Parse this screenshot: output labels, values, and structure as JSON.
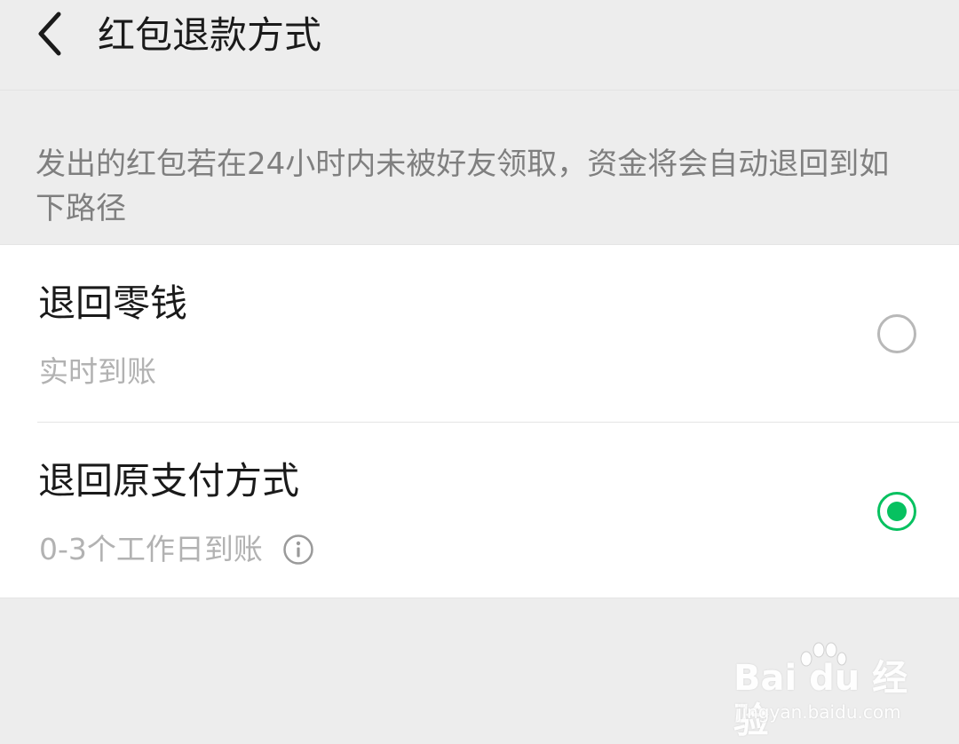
{
  "header": {
    "back_icon": "chevron-left-icon",
    "title": "红包退款方式"
  },
  "description": "发出的红包若在24小时内未被好友领取，资金将会自动退回到如下路径",
  "options": [
    {
      "title": "退回零钱",
      "subtitle": "实时到账",
      "selected": false
    },
    {
      "title": "退回原支付方式",
      "subtitle": "0-3个工作日到账",
      "selected": true,
      "info_icon": "info-icon"
    }
  ],
  "colors": {
    "accent": "#07c160",
    "background": "#ededed",
    "card": "#ffffff"
  },
  "watermark": {
    "logo": "Bai du 经验",
    "url": "jingyan.baidu.com"
  }
}
